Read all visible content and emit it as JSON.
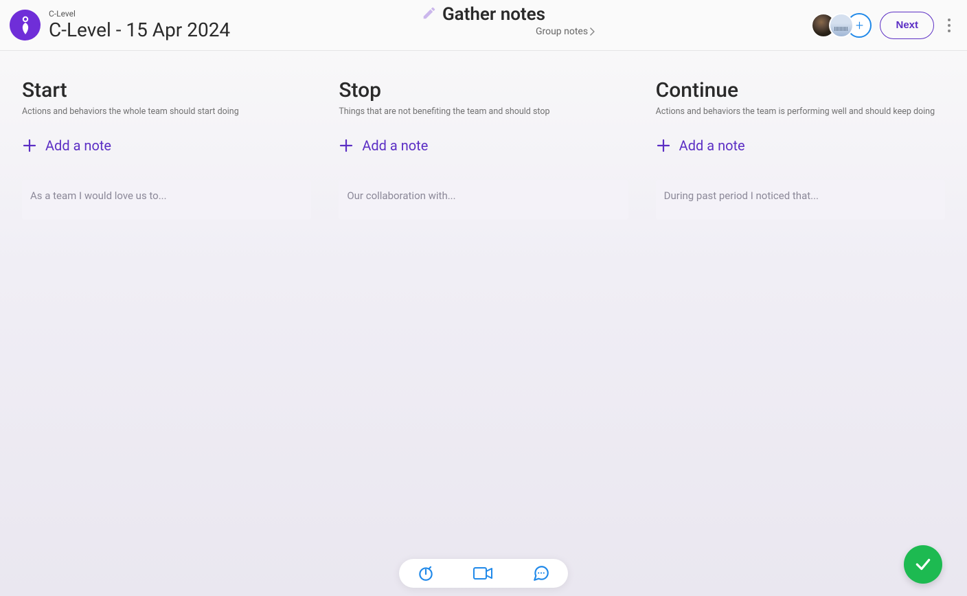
{
  "header": {
    "breadcrumb": "C-Level",
    "title": "C-Level - 15 Apr 2024",
    "stage": "Gather notes",
    "next_stage": "Group notes",
    "next_button": "Next"
  },
  "columns": [
    {
      "title": "Start",
      "description": "Actions and behaviors the whole team should start doing",
      "add_label": "Add a note",
      "placeholder": "As a team I would love us to..."
    },
    {
      "title": "Stop",
      "description": "Things that are not benefiting the team and should stop",
      "add_label": "Add a note",
      "placeholder": "Our collaboration with..."
    },
    {
      "title": "Continue",
      "description": "Actions and behaviors the team is performing well and should keep doing",
      "add_label": "Add a note",
      "placeholder": "During past period I noticed that..."
    }
  ],
  "icons": {
    "add_user": "+"
  }
}
